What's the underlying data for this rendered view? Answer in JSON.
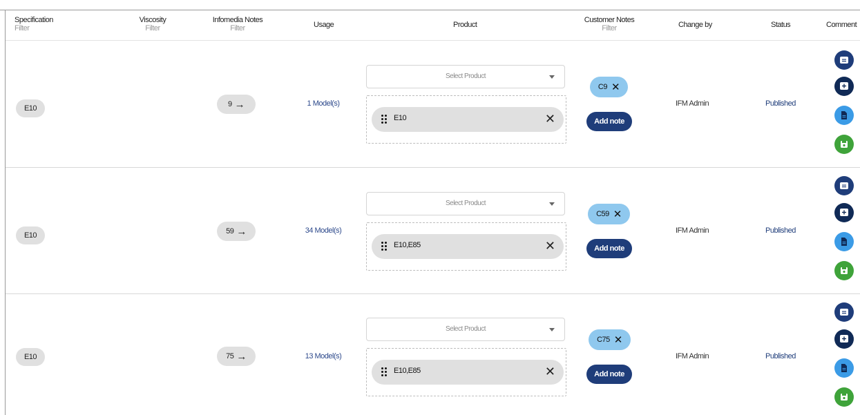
{
  "header": {
    "specification": "Specification",
    "specification_filter": "Filter",
    "viscosity": "Viscosity",
    "viscosity_filter": "Filter",
    "infomedia_notes": "Infomedia Notes",
    "infomedia_filter": "Filter",
    "usage": "Usage",
    "product": "Product",
    "customer_notes": "Customer Notes",
    "customer_filter": "Filter",
    "change_by": "Change by",
    "status": "Status",
    "comment": "Comment"
  },
  "rows": [
    {
      "specification": "E10",
      "infomedia_count": "9",
      "usage": "1 Model(s)",
      "select_placeholder": "Select Product",
      "products": "E10",
      "customer_note": "C9",
      "add_note": "Add note",
      "change_by": "IFM Admin",
      "status": "Published"
    },
    {
      "specification": "E10",
      "infomedia_count": "59",
      "usage": "34 Model(s)",
      "select_placeholder": "Select Product",
      "products": "E10,E85",
      "customer_note": "C59",
      "add_note": "Add note",
      "change_by": "IFM Admin",
      "status": "Published"
    },
    {
      "specification": "E10",
      "infomedia_count": "75",
      "usage": "13 Model(s)",
      "select_placeholder": "Select Product",
      "products": "E10,E85",
      "customer_note": "C75",
      "add_note": "Add note",
      "change_by": "IFM Admin",
      "status": "Published"
    }
  ],
  "icons": {
    "arrow": "arrow-right-icon",
    "grip": "drag-handle-icon",
    "remove": "close-icon",
    "comment_actions": [
      "comment-icon",
      "add-comment-icon",
      "document-icon",
      "save-icon"
    ]
  },
  "colors": {
    "accent": "#1f3d7a",
    "note_chip": "#8fc8ee",
    "document_button": "#3b9be6",
    "save_button": "#3fa33a"
  }
}
